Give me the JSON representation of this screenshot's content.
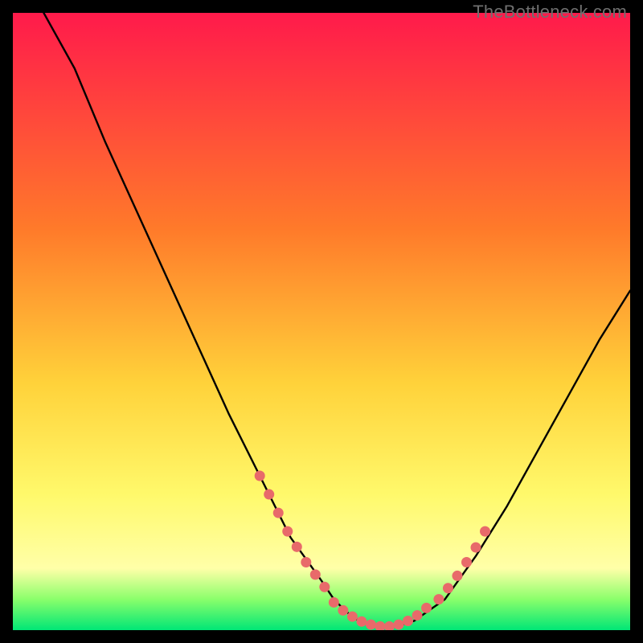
{
  "watermark": "TheBottleneck.com",
  "colors": {
    "gradient_top": "#ff1a4b",
    "gradient_mid1": "#ff7a2a",
    "gradient_mid2": "#ffd23a",
    "gradient_mid3": "#fff96b",
    "gradient_bottom_yellow": "#ffffa8",
    "gradient_green1": "#8aff6b",
    "gradient_green2": "#00e676",
    "curve": "#000000",
    "marker": "#e86a6a",
    "background": "#000000"
  },
  "chart_data": {
    "type": "line",
    "title": "",
    "xlabel": "",
    "ylabel": "",
    "xlim": [
      0,
      100
    ],
    "ylim": [
      0,
      100
    ],
    "series": [
      {
        "name": "bottleneck-curve",
        "x": [
          5,
          10,
          15,
          20,
          25,
          30,
          35,
          40,
          45,
          50,
          52,
          54,
          56,
          58,
          60,
          62,
          65,
          70,
          75,
          80,
          85,
          90,
          95,
          100
        ],
        "y": [
          100,
          91,
          79,
          68,
          57,
          46,
          35,
          25,
          15,
          8,
          5,
          3,
          1.5,
          0.7,
          0.5,
          0.6,
          1.5,
          5,
          12,
          20,
          29,
          38,
          47,
          55
        ]
      }
    ],
    "markers_left": {
      "name": "highlight-left",
      "x": [
        40,
        41.5,
        43,
        44.5,
        46,
        47.5,
        49,
        50.5
      ],
      "y": [
        25,
        22,
        19,
        16,
        13.5,
        11,
        9,
        7
      ]
    },
    "markers_valley": {
      "name": "highlight-valley",
      "x": [
        52,
        53.5,
        55,
        56.5,
        58,
        59.5,
        61,
        62.5,
        64,
        65.5,
        67
      ],
      "y": [
        4.5,
        3.2,
        2.2,
        1.4,
        0.9,
        0.6,
        0.6,
        0.9,
        1.5,
        2.4,
        3.6
      ]
    },
    "markers_right": {
      "name": "highlight-right",
      "x": [
        69,
        70.5,
        72,
        73.5,
        75,
        76.5
      ],
      "y": [
        5,
        6.8,
        8.8,
        11,
        13.4,
        16
      ]
    }
  }
}
